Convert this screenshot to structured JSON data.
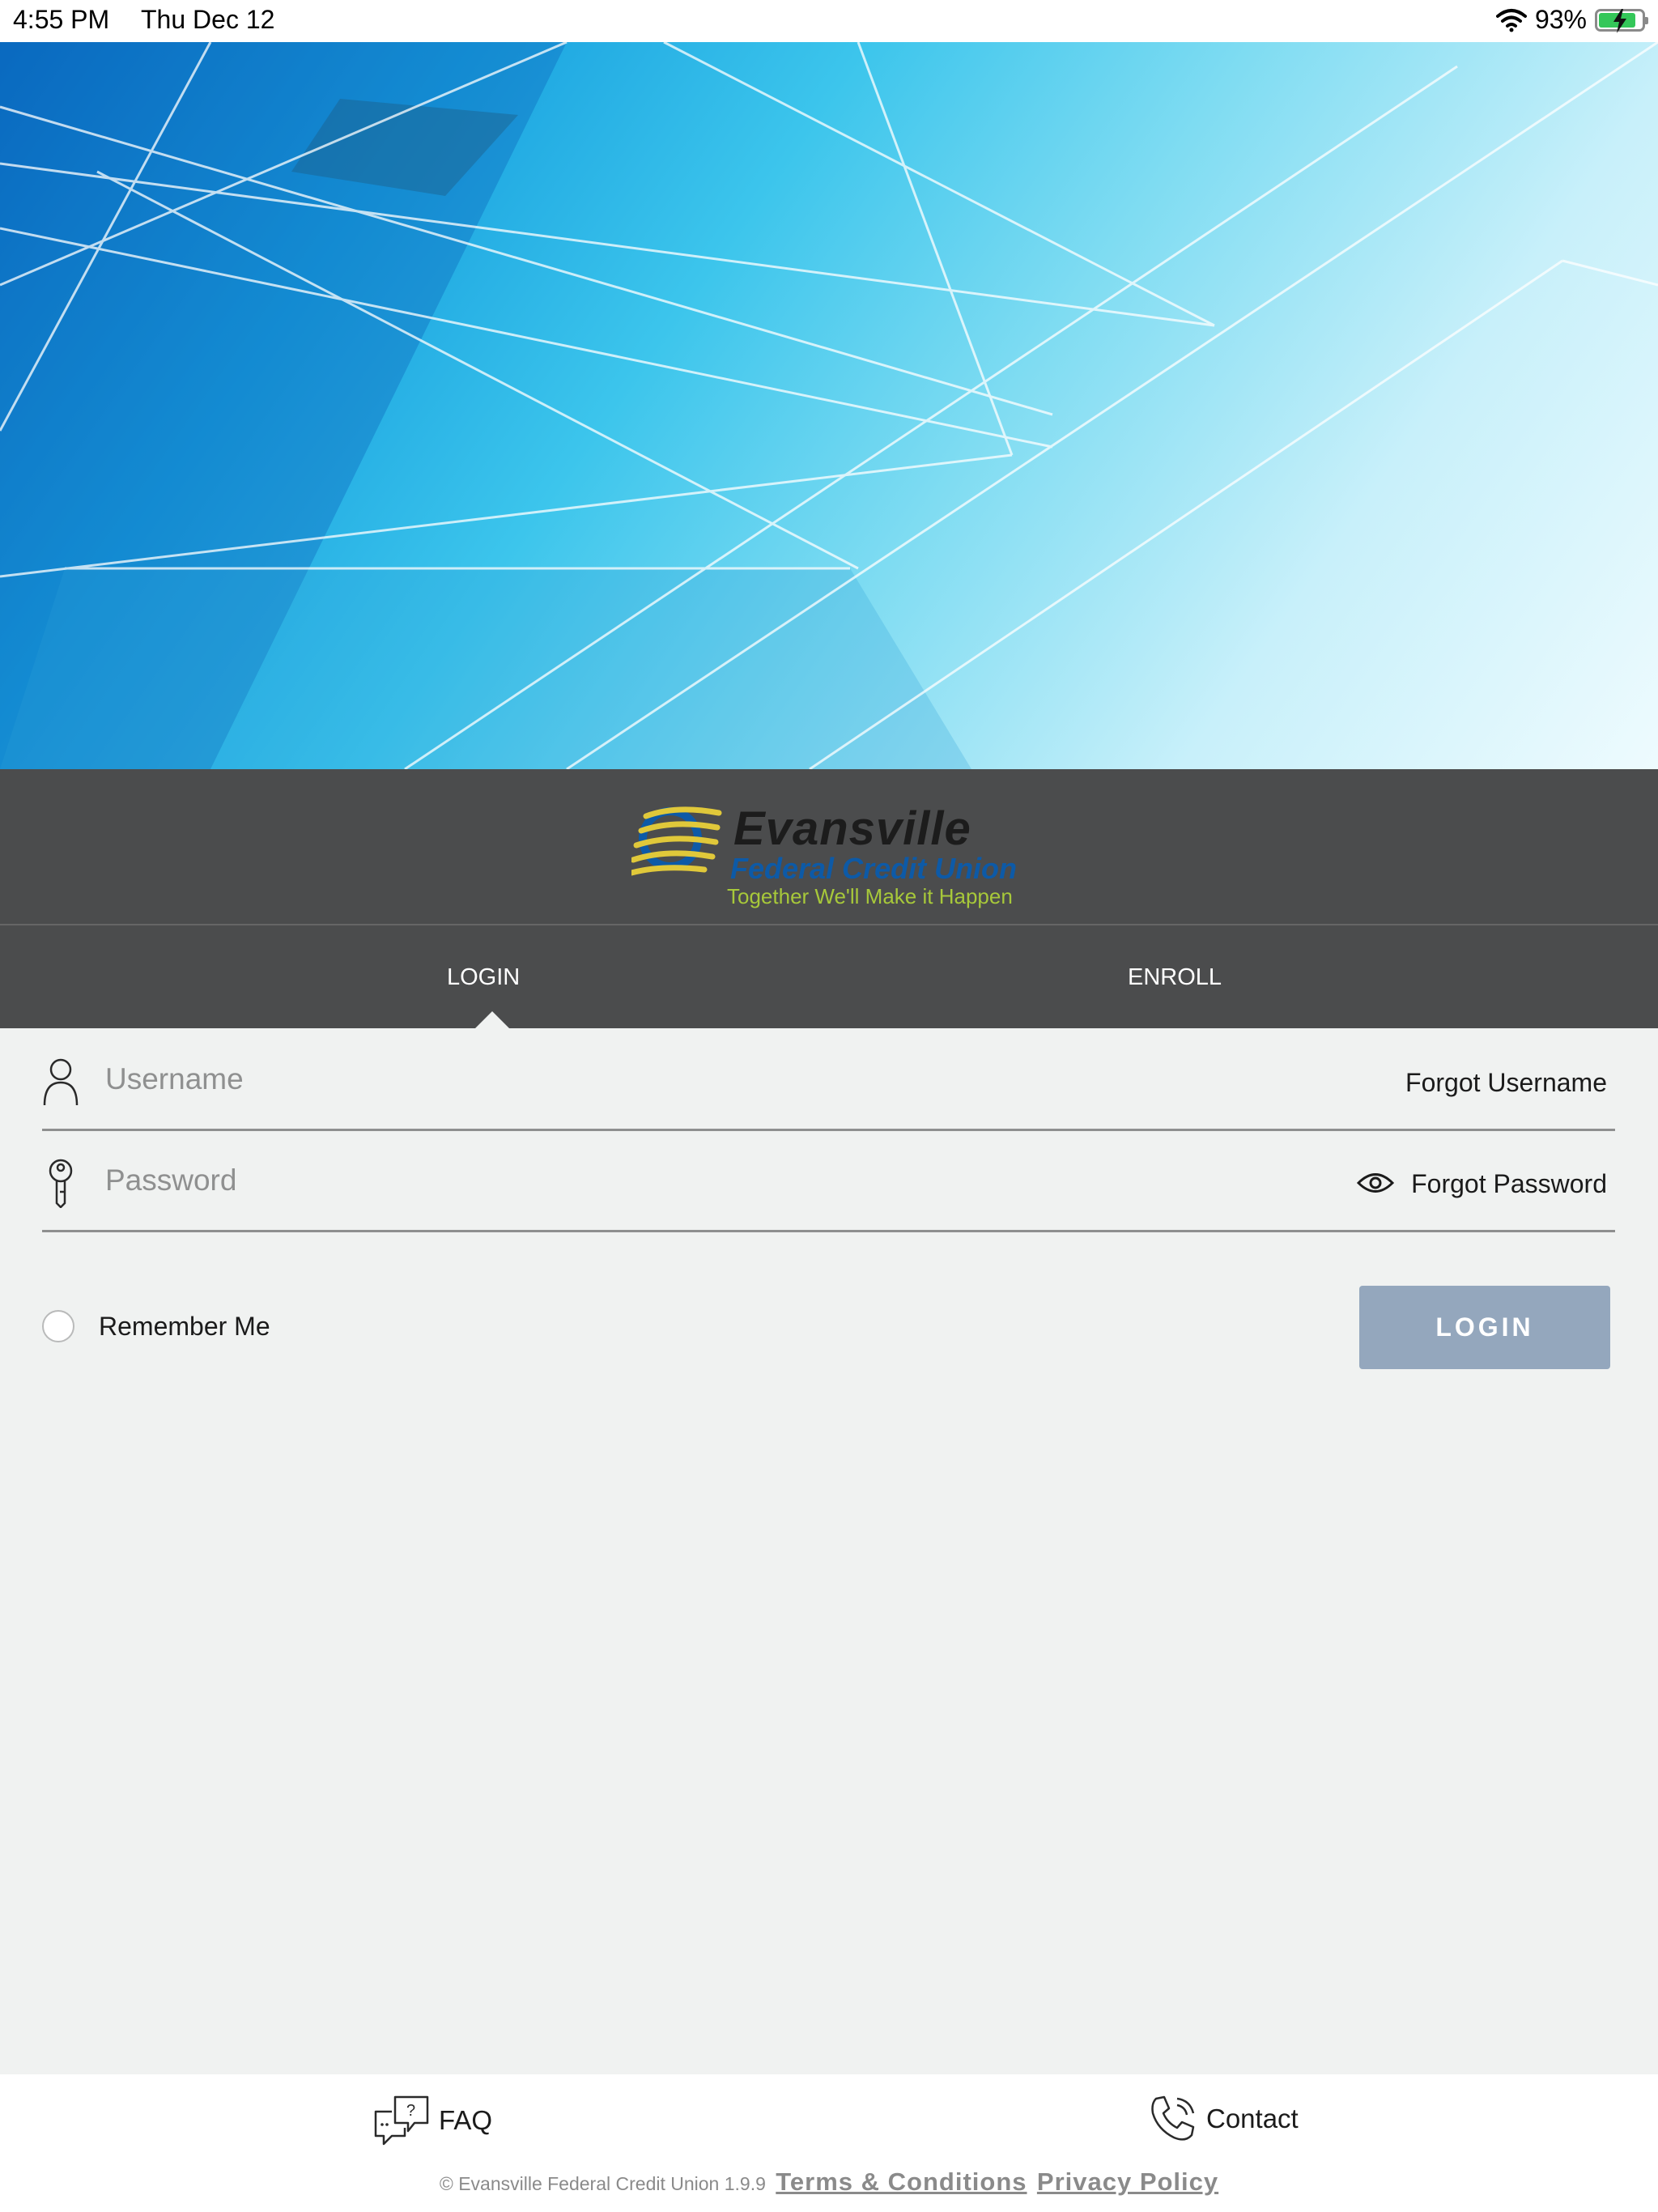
{
  "status_bar": {
    "time": "4:55 PM",
    "date": "Thu Dec 12",
    "battery": "93%"
  },
  "brand": {
    "name": "Evansville",
    "subtitle": "Federal Credit Union",
    "tagline": "Together We'll Make it Happen",
    "colors": {
      "blue": "#0d5aa7",
      "yellow": "#e0c83a",
      "green": "#a7c83a"
    }
  },
  "tabs": [
    {
      "label": "LOGIN",
      "active": true
    },
    {
      "label": "ENROLL",
      "active": false
    }
  ],
  "form": {
    "username_placeholder": "Username",
    "forgot_username": "Forgot Username",
    "password_placeholder": "Password",
    "forgot_password": "Forgot Password",
    "remember_me": "Remember Me",
    "login_button": "LOGIN"
  },
  "footer": {
    "faq": "FAQ",
    "contact": "Contact",
    "copyright": "© Evansville Federal Credit Union 1.9.9",
    "terms": "Terms & Conditions",
    "privacy": "Privacy Policy"
  },
  "colors": {
    "accent_gray": "#4b4c4d",
    "button": "#94a7bd",
    "background": "#f0f2f1"
  }
}
